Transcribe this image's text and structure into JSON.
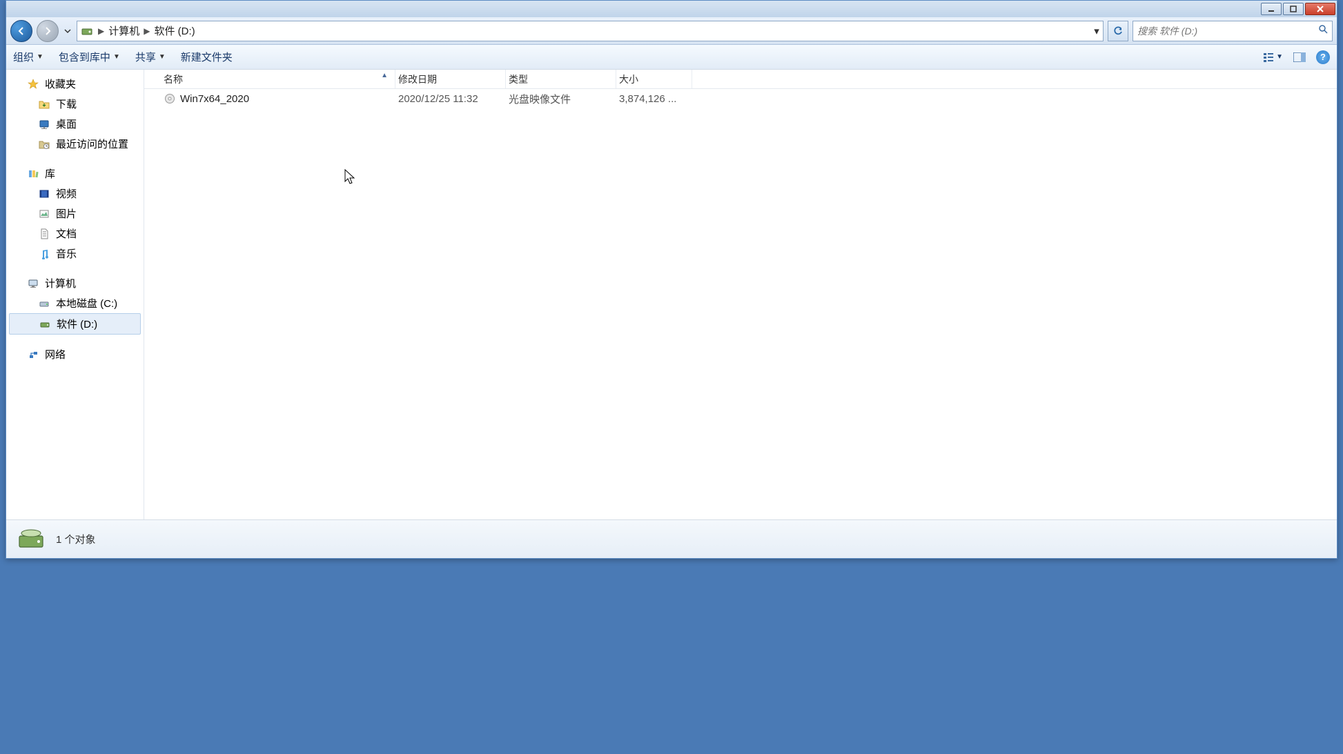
{
  "breadcrumb": {
    "seg1": "计算机",
    "seg2": "软件 (D:)"
  },
  "search": {
    "placeholder": "搜索 软件 (D:)"
  },
  "toolbar": {
    "organize": "组织",
    "include": "包含到库中",
    "share": "共享",
    "newfolder": "新建文件夹"
  },
  "columns": {
    "name": "名称",
    "date": "修改日期",
    "type": "类型",
    "size": "大小"
  },
  "rows": [
    {
      "name": "Win7x64_2020",
      "date": "2020/12/25 11:32",
      "type": "光盘映像文件",
      "size": "3,874,126 ..."
    }
  ],
  "sidebar": {
    "fav": "收藏夹",
    "fav_items": {
      "downloads": "下载",
      "desktop": "桌面",
      "recent": "最近访问的位置"
    },
    "lib": "库",
    "lib_items": {
      "video": "视频",
      "pic": "图片",
      "doc": "文档",
      "music": "音乐"
    },
    "computer": "计算机",
    "comp_items": {
      "cdrive": "本地磁盘 (C:)",
      "ddrive": "软件 (D:)"
    },
    "network": "网络"
  },
  "status": {
    "count": "1 个对象"
  }
}
